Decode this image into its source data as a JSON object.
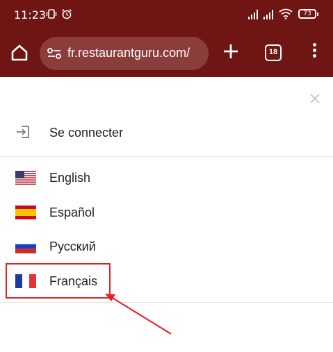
{
  "status_bar": {
    "time": "11:23",
    "battery": "73"
  },
  "browser": {
    "url": "fr.restaurantguru.com/",
    "tab_count": "18",
    "theme_color": "#6f1514"
  },
  "menu": {
    "login_label": "Se connecter",
    "languages": [
      {
        "label": "English",
        "flag": "us-flag-icon"
      },
      {
        "label": "Español",
        "flag": "spain-flag-icon"
      },
      {
        "label": "Русский",
        "flag": "russia-flag-icon"
      },
      {
        "label": "Français",
        "flag": "france-flag-icon"
      }
    ]
  },
  "annotation": {
    "highlight_color": "#e32222",
    "highlighted_item": "Français"
  }
}
